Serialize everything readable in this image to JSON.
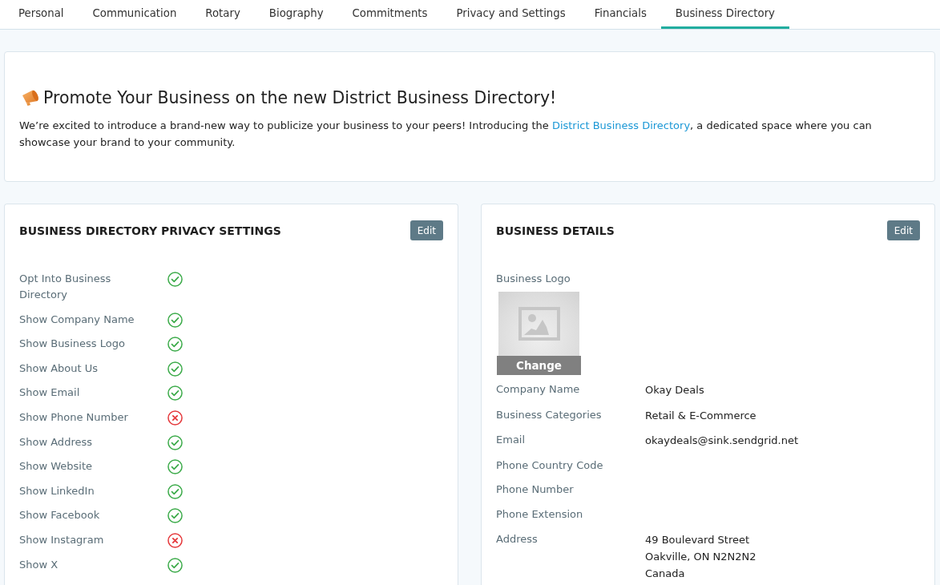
{
  "tabs": [
    {
      "label": "Personal",
      "selected": false
    },
    {
      "label": "Communication",
      "selected": false
    },
    {
      "label": "Rotary",
      "selected": false
    },
    {
      "label": "Biography",
      "selected": false
    },
    {
      "label": "Commitments",
      "selected": false
    },
    {
      "label": "Privacy and Settings",
      "selected": false
    },
    {
      "label": "Financials",
      "selected": false
    },
    {
      "label": "Business Directory",
      "selected": true
    }
  ],
  "announcement": {
    "title": "Promote Your Business on the new District Business Directory!",
    "body": [
      {
        "kind": "text",
        "text": "We’re excited to introduce a brand-new way to publicize your business to your peers! Introducing the "
      },
      {
        "kind": "link",
        "text": "District Business Directory"
      },
      {
        "kind": "text",
        "text": ", a dedicated space where you can showcase your brand to your community."
      }
    ]
  },
  "privacy_settings": {
    "title": "BUSINESS DIRECTORY PRIVACY SETTINGS",
    "edit_button": "Edit",
    "items": [
      {
        "label": "Opt Into Business Directory",
        "enabled": true
      },
      {
        "label": "Show Company Name",
        "enabled": true
      },
      {
        "label": "Show Business Logo",
        "enabled": true
      },
      {
        "label": "Show About Us",
        "enabled": true
      },
      {
        "label": "Show Email",
        "enabled": true
      },
      {
        "label": "Show Phone Number",
        "enabled": false
      },
      {
        "label": "Show Address",
        "enabled": true
      },
      {
        "label": "Show Website",
        "enabled": true
      },
      {
        "label": "Show LinkedIn",
        "enabled": true
      },
      {
        "label": "Show Facebook",
        "enabled": true
      },
      {
        "label": "Show Instagram",
        "enabled": false
      },
      {
        "label": "Show X",
        "enabled": true
      }
    ]
  },
  "business_details": {
    "title": "BUSINESS DETAILS",
    "edit_button": "Edit",
    "logo": {
      "label": "Business Logo",
      "change_button": "Change"
    },
    "fields": [
      {
        "label": "Company Name",
        "kind": "text",
        "value": "Okay Deals"
      },
      {
        "label": "Business Categories",
        "kind": "text",
        "value": "Retail & E-Commerce"
      },
      {
        "label": "Email",
        "kind": "link",
        "value": "okaydeals@sink.sendgrid.net"
      },
      {
        "label": "Phone Country Code",
        "kind": "empty"
      },
      {
        "label": "Phone Number",
        "kind": "empty"
      },
      {
        "label": "Phone Extension",
        "kind": "empty"
      },
      {
        "label": "Address",
        "kind": "address",
        "lines": [
          "49 Boulevard Street",
          "Oakville, ON N2N2N2",
          "Canada"
        ]
      }
    ]
  }
}
